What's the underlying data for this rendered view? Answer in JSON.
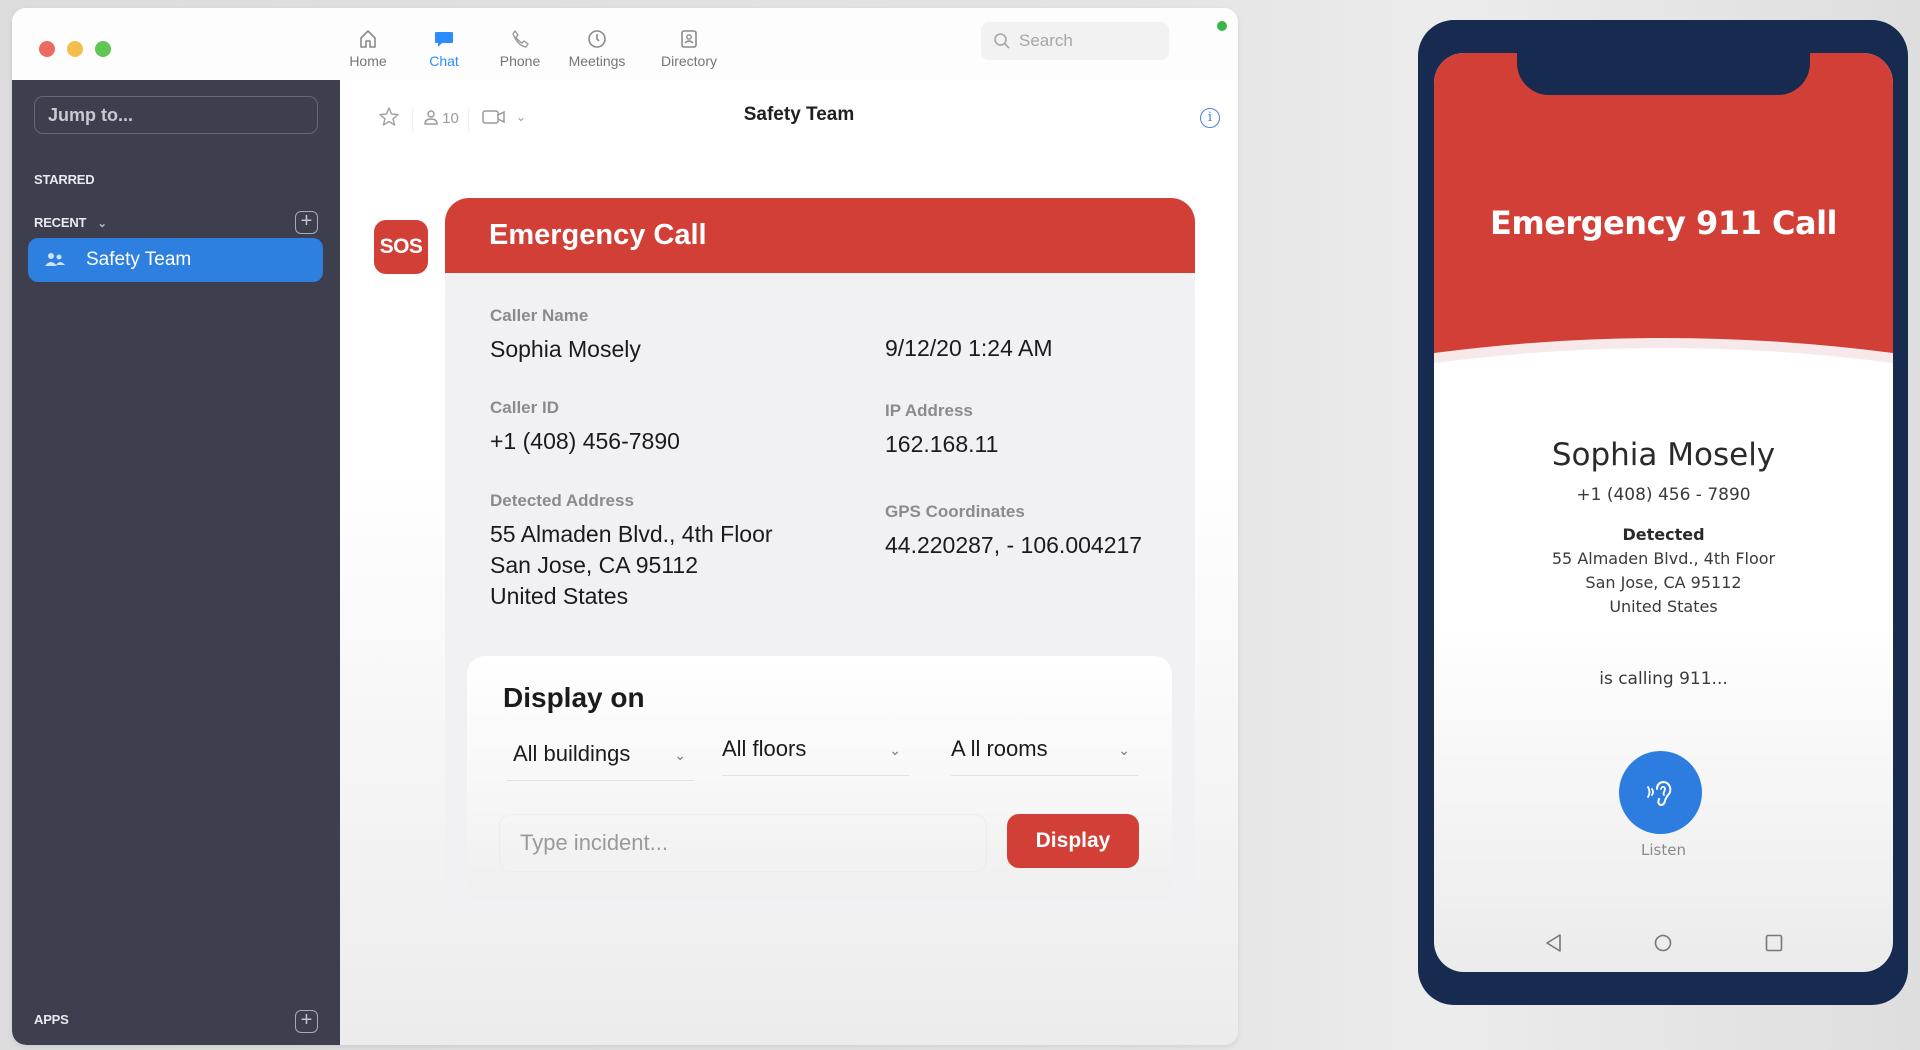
{
  "window": {
    "nav_tabs": [
      {
        "label": "Home",
        "icon": "home-icon",
        "active": false
      },
      {
        "label": "Chat",
        "icon": "chat-icon",
        "active": true
      },
      {
        "label": "Phone",
        "icon": "phone-icon",
        "active": false
      },
      {
        "label": "Meetings",
        "icon": "clock-icon",
        "active": false
      },
      {
        "label": "Directory",
        "icon": "contact-card-icon",
        "active": false
      }
    ],
    "search_placeholder": "Search",
    "accent_color": "#2d8cff",
    "status_color": "#3bb54a"
  },
  "sidebar": {
    "jump_placeholder": "Jump to...",
    "starred_label": "STARRED",
    "recent_label": "RECENT",
    "channels": [
      {
        "label": "Safety Team",
        "icon": "group-icon",
        "selected": true
      }
    ],
    "apps_label": "APPS"
  },
  "chat": {
    "title": "Safety Team",
    "member_count": "10",
    "sos_badge": "SOS",
    "card": {
      "title": "Emergency Call",
      "caller_name_label": "Caller Name",
      "caller_name": "Sophia Mosely",
      "timestamp": "9/12/20 1:24 AM",
      "caller_id_label": "Caller ID",
      "caller_id": "+1 (408) 456-7890",
      "ip_label": "IP Address",
      "ip": "162.168.11",
      "address_label": "Detected Address",
      "address_lines": [
        "55 Almaden Blvd., 4th Floor",
        "San Jose, CA 95112",
        "United States"
      ],
      "gps_label": "GPS Coordinates",
      "gps": "44.220287, - 106.004217",
      "display_on_title": "Display on",
      "dropdowns": [
        {
          "selected": "All buildings"
        },
        {
          "selected": "All floors"
        },
        {
          "selected": "A ll rooms"
        }
      ],
      "incident_placeholder": "Type incident...",
      "display_button": "Display",
      "brand_red": "#d23f37"
    }
  },
  "phone": {
    "title": "Emergency 911 Call",
    "caller_name": "Sophia Mosely",
    "caller_number": "+1 (408) 456 - 7890",
    "detected_label": "Detected",
    "address_lines": [
      "55 Almaden Blvd., 4th Floor",
      "San Jose, CA 95112",
      "United States"
    ],
    "status": "is calling 911...",
    "listen_label": "Listen",
    "frame_color": "#172a4f"
  }
}
